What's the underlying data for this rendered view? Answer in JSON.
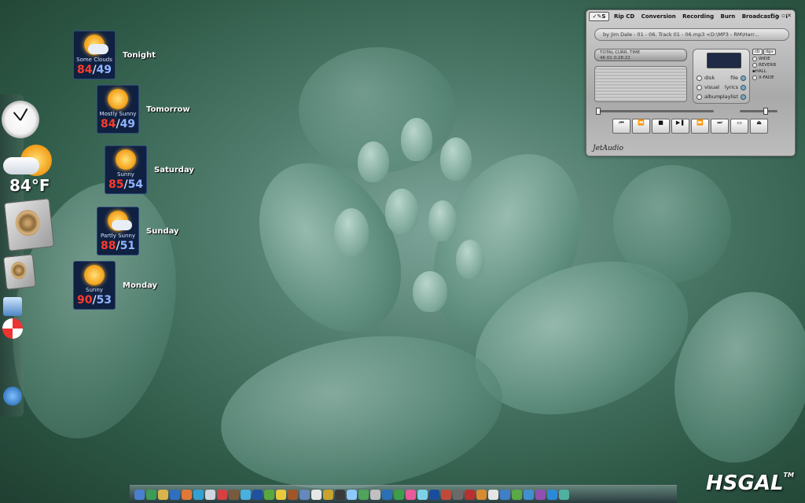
{
  "forecast": [
    {
      "day": "Tonight",
      "condition": "Some Clouds",
      "high": "84",
      "low": "49",
      "icon": "partly-cloudy-icon"
    },
    {
      "day": "Tomorrow",
      "condition": "Mostly Sunny",
      "high": "84",
      "low": "49",
      "icon": "sun-icon"
    },
    {
      "day": "Saturday",
      "condition": "Sunny",
      "high": "85",
      "low": "54",
      "icon": "sun-icon"
    },
    {
      "day": "Sunday",
      "condition": "Partly Sunny",
      "high": "88",
      "low": "51",
      "icon": "partly-sunny-icon"
    },
    {
      "day": "Monday",
      "condition": "Sunny",
      "high": "90",
      "low": "53",
      "icon": "sun-icon"
    }
  ],
  "current_weather": {
    "temp": "84°F"
  },
  "player": {
    "menu": [
      "Rip CD",
      "Conversion",
      "Recording",
      "Burn",
      "Broadcastig"
    ],
    "now_playing": "by Jim Dale - 01 - 06. Track 01 - 06.mp3    <D:\\MP3 - RM\\Harr...",
    "time_labels": "TOTAL CURR. TIME",
    "time_values": "46   01     0:28:22",
    "options_left": [
      "disk",
      "visual",
      "album"
    ],
    "options_right": [
      "file",
      "lyrics",
      "playlist"
    ],
    "eq": {
      "preset1": "cb",
      "preset2": "dgv",
      "effects": [
        "WIDE",
        "REVERB",
        "HALL",
        "X-FADE"
      ]
    },
    "brand": "JetAudio"
  },
  "logo": {
    "text": "HSGAL",
    "tm": "TM"
  }
}
